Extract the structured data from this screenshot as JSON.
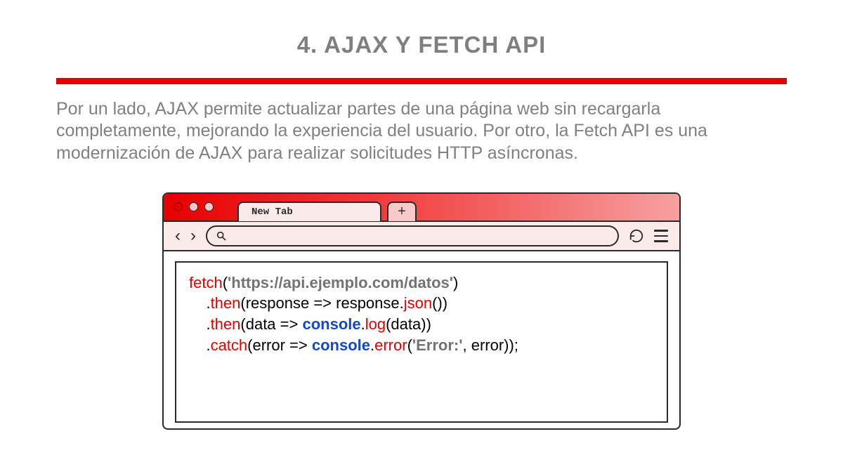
{
  "title": "4. AJAX Y FETCH API",
  "description": "Por un lado, AJAX permite actualizar partes de una página web sin recargarla completamente, mejorando la experiencia del usuario. Por otro, la Fetch API es una modernización de AJAX para realizar solicitudes HTTP asíncronas.",
  "browser": {
    "tab_label": "New Tab",
    "new_tab_symbol": "+"
  },
  "code": {
    "fetch": "fetch",
    "url": "'https://api.ejemplo.com/datos'",
    "then": "then",
    "response_arrow": "(response => response.",
    "json": "json",
    "close_json": "())",
    "data_arrow": "(data => ",
    "console": "console",
    "log": "log",
    "close_log": "(data))",
    "catch": "catch",
    "error_arrow": "(error => ",
    "error_method": "error",
    "error_str": "'Error:'",
    "close_error": ", error));"
  }
}
